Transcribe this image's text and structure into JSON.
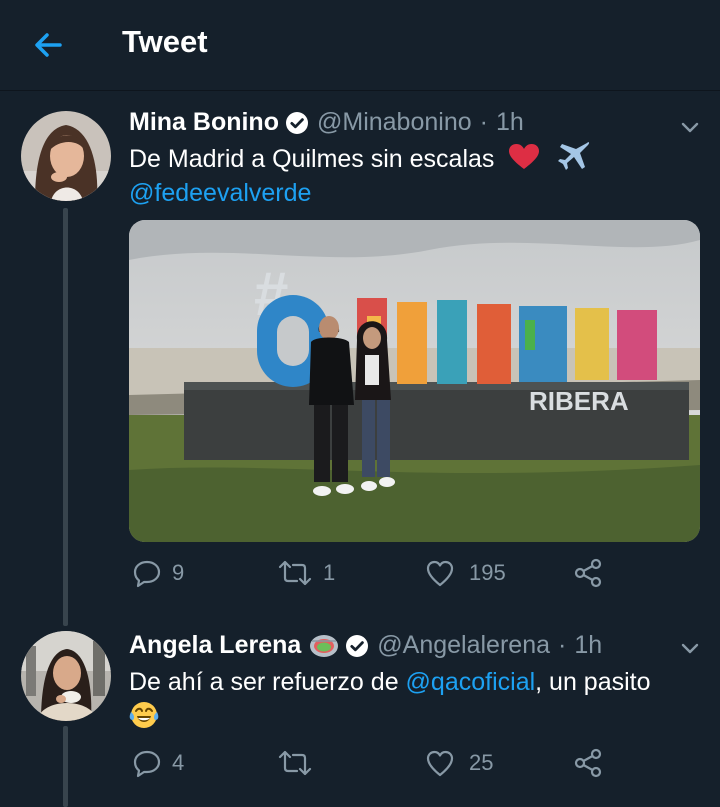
{
  "header": {
    "title": "Tweet"
  },
  "tweets": [
    {
      "name": "Mina Bonino",
      "handle": "@Minabonino",
      "time": "1h",
      "text_before_emoji": "De Madrid a Quilmes sin escalas",
      "emoji": [
        "red-heart-icon",
        "airplane-icon"
      ],
      "mention": "@fedeevalverde",
      "photo_sign_text": "QUILMES",
      "photo_sign_sub": "RIBERA",
      "photo_sign_hash": "#",
      "counts": {
        "replies": "9",
        "retweets": "1",
        "likes": "195"
      }
    },
    {
      "name": "Angela Lerena",
      "name_emoji": "stadium-icon",
      "handle": "@Angelalerena",
      "time": "1h",
      "text_before_link": "De ahí a ser refuerzo de ",
      "mention": "@qacoficial",
      "text_after_link": ", un pasito",
      "emoji": [
        "tears-of-joy-icon"
      ],
      "counts": {
        "replies": "4",
        "retweets": "",
        "likes": "25"
      }
    }
  ],
  "colors": {
    "background": "#15202b",
    "accent": "#1da1f2",
    "muted": "#8899a6",
    "divider": "#38444d"
  }
}
